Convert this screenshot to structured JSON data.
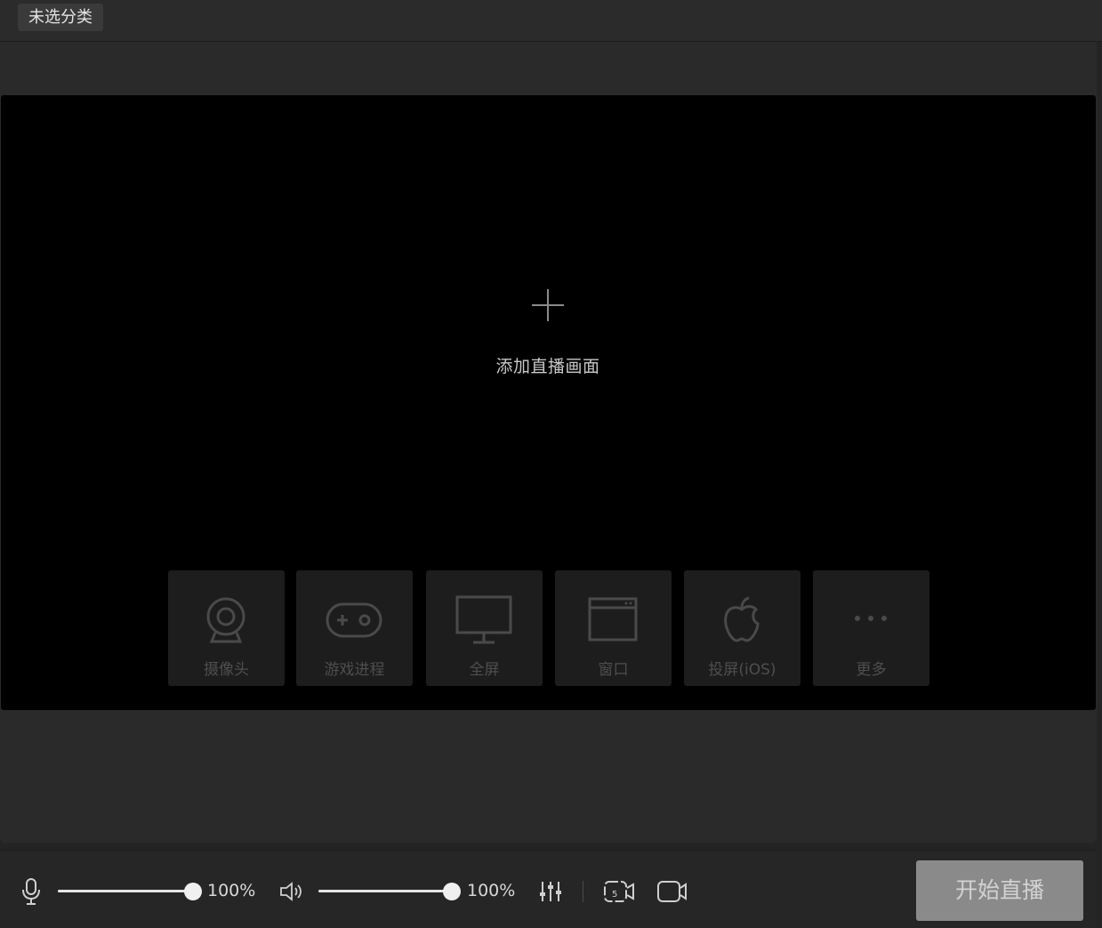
{
  "header": {
    "category_label": "未选分类"
  },
  "preview": {
    "add_scene_label": "添加直播画面"
  },
  "sources": [
    {
      "label": "摄像头",
      "icon": "webcam-icon"
    },
    {
      "label": "游戏进程",
      "icon": "gamepad-icon"
    },
    {
      "label": "全屏",
      "icon": "monitor-icon"
    },
    {
      "label": "窗口",
      "icon": "window-icon"
    },
    {
      "label": "投屏(iOS)",
      "icon": "apple-icon"
    },
    {
      "label": "更多",
      "icon": "more-icon"
    }
  ],
  "controls": {
    "mic_volume_pct": 100,
    "mic_volume_text": "100%",
    "speaker_volume_pct": 100,
    "speaker_volume_text": "100%",
    "start_label": "开始直播"
  },
  "colors": {
    "background": "#242424",
    "preview": "#000000",
    "start_button": "#8a8a8a"
  }
}
